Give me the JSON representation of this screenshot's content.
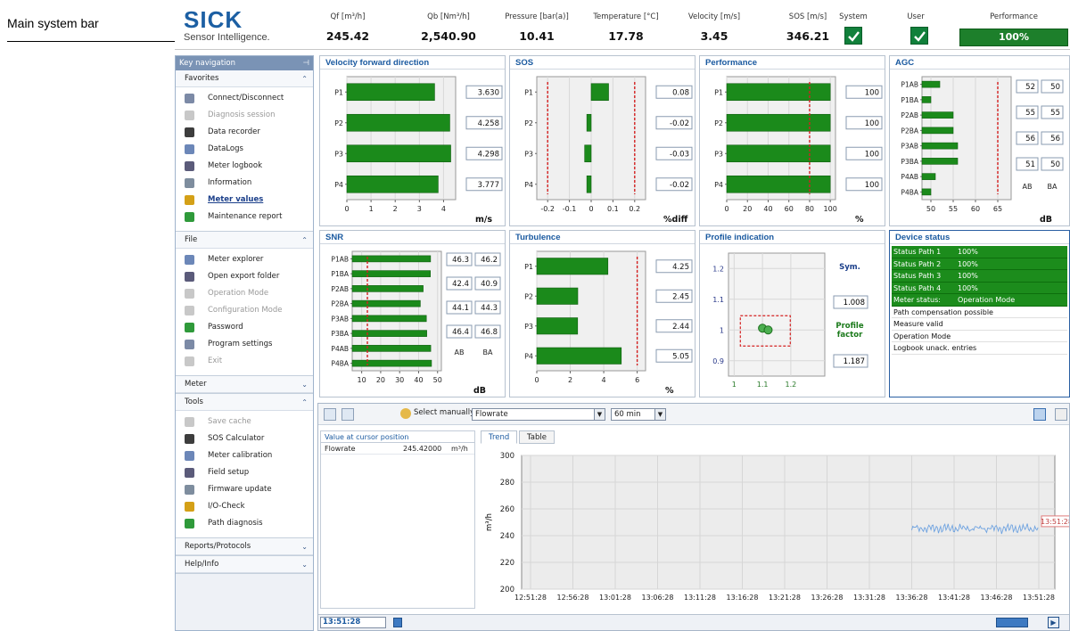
{
  "callout": {
    "label": "Main system bar"
  },
  "brand": {
    "name": "SICK",
    "tagline": "Sensor Intelligence."
  },
  "system_bar": {
    "metrics": [
      {
        "header": "Qf [m³/h]",
        "value": "245.42"
      },
      {
        "header": "Qb [Nm³/h]",
        "value": "2,540.90"
      },
      {
        "header": "Pressure [bar(a)]",
        "value": "10.41"
      },
      {
        "header": "Temperature [°C]",
        "value": "17.78"
      },
      {
        "header": "Velocity [m/s]",
        "value": "3.45"
      },
      {
        "header": "SOS [m/s]",
        "value": "346.21"
      }
    ],
    "system_label": "System",
    "user_label": "User",
    "performance_label": "Performance",
    "performance_value": "100%",
    "performance_level": 1.0,
    "colors": {
      "check": "#11803b",
      "performance": "#1d7f2b",
      "accent": "#1b5aa0"
    }
  },
  "sidebar": {
    "title": "Key navigation",
    "groups": [
      {
        "name": "Favorites",
        "expanded": true,
        "items": [
          {
            "label": "Connect/Disconnect",
            "icon": "plug-icon",
            "enabled": true
          },
          {
            "label": "Diagnosis session",
            "icon": "diagnosis-icon",
            "enabled": false
          },
          {
            "label": "Data recorder",
            "icon": "recorder-icon",
            "enabled": true
          },
          {
            "label": "DataLogs",
            "icon": "datalogs-icon",
            "enabled": true
          },
          {
            "label": "Meter logbook",
            "icon": "logbook-icon",
            "enabled": true
          },
          {
            "label": "Information",
            "icon": "information-icon",
            "enabled": true
          },
          {
            "label": "Meter values",
            "icon": "meter-values-icon",
            "enabled": true,
            "active": true
          },
          {
            "label": "Maintenance report",
            "icon": "report-icon",
            "enabled": true
          }
        ]
      },
      {
        "name": "File",
        "expanded": true,
        "items": [
          {
            "label": "Meter explorer",
            "icon": "explorer-icon",
            "enabled": true
          },
          {
            "label": "Open export folder",
            "icon": "folder-icon",
            "enabled": true
          },
          {
            "label": "Operation Mode",
            "icon": "operation-icon",
            "enabled": false
          },
          {
            "label": "Configuration Mode",
            "icon": "configuration-icon",
            "enabled": false
          },
          {
            "label": "Password",
            "icon": "password-icon",
            "enabled": true
          },
          {
            "label": "Program settings",
            "icon": "settings-icon",
            "enabled": true
          },
          {
            "label": "Exit",
            "icon": "exit-icon",
            "enabled": false
          }
        ]
      },
      {
        "name": "Meter",
        "expanded": false,
        "items": []
      },
      {
        "name": "Tools",
        "expanded": true,
        "items": [
          {
            "label": "Save cache",
            "icon": "cache-icon",
            "enabled": false
          },
          {
            "label": "SOS Calculator",
            "icon": "calculator-icon",
            "enabled": true
          },
          {
            "label": "Meter calibration",
            "icon": "calibration-icon",
            "enabled": true
          },
          {
            "label": "Field setup",
            "icon": "field-setup-icon",
            "enabled": true
          },
          {
            "label": "Firmware update",
            "icon": "firmware-icon",
            "enabled": true
          },
          {
            "label": "I/O-Check",
            "icon": "io-check-icon",
            "enabled": true
          },
          {
            "label": "Path diagnosis",
            "icon": "path-diagnosis-icon",
            "enabled": true
          }
        ]
      },
      {
        "name": "Reports/Protocols",
        "expanded": false,
        "items": []
      },
      {
        "name": "Help/Info",
        "expanded": false,
        "items": []
      }
    ]
  },
  "chart_data": [
    {
      "id": "velocity",
      "type": "bar",
      "title": "Velocity  forward direction",
      "categories": [
        "P1",
        "P2",
        "P3",
        "P4"
      ],
      "values": [
        3.63,
        4.258,
        4.298,
        3.777
      ],
      "value_labels": [
        "3.630",
        "4.258",
        "4.298",
        "3.777"
      ],
      "unit": "m/s",
      "xlim": [
        0,
        4.5
      ],
      "xticks": [
        "0",
        "1",
        "2",
        "3",
        "4"
      ]
    },
    {
      "id": "sos",
      "type": "bar",
      "title": "SOS",
      "categories": [
        "P1",
        "P2",
        "P3",
        "P4"
      ],
      "values": [
        0.08,
        -0.02,
        -0.03,
        -0.02
      ],
      "value_labels": [
        "0.08",
        "-0.02",
        "-0.03",
        "-0.02"
      ],
      "unit": "%diff",
      "xlim": [
        -0.25,
        0.25
      ],
      "xticks": [
        "-0.2",
        "-0.1",
        "0",
        "0.1",
        "0.2"
      ],
      "limits": [
        -0.2,
        0.2
      ]
    },
    {
      "id": "performance",
      "type": "bar",
      "title": "Performance",
      "categories": [
        "P1",
        "P2",
        "P3",
        "P4"
      ],
      "values": [
        100,
        100,
        100,
        100
      ],
      "value_labels": [
        "100",
        "100",
        "100",
        "100"
      ],
      "unit": "%",
      "xlim": [
        0,
        105
      ],
      "xticks": [
        "0",
        "20",
        "40",
        "60",
        "80",
        "100"
      ],
      "limits": [
        80
      ]
    },
    {
      "id": "agc",
      "type": "bar",
      "title": "AGC",
      "categories": [
        "P1AB",
        "P1BA",
        "P2AB",
        "P2BA",
        "P3AB",
        "P3BA",
        "P4AB",
        "P4BA"
      ],
      "values": [
        52,
        50,
        55,
        55,
        56,
        56,
        51,
        50
      ],
      "value_labels": [
        "52",
        "50",
        "55",
        "55",
        "56",
        "56",
        "51",
        "50"
      ],
      "unit": "dB",
      "xlim": [
        48,
        68
      ],
      "xticks": [
        "50",
        "55",
        "60",
        "65"
      ],
      "limits": [
        65
      ],
      "col_labels": [
        "AB",
        "BA"
      ]
    },
    {
      "id": "snr",
      "type": "bar",
      "title": "SNR",
      "categories": [
        "P1AB",
        "P1BA",
        "P2AB",
        "P2BA",
        "P3AB",
        "P3BA",
        "P4AB",
        "P4BA"
      ],
      "values": [
        46.3,
        46.2,
        42.4,
        40.9,
        44.1,
        44.3,
        46.4,
        46.8
      ],
      "value_labels": [
        "46.3",
        "46.2",
        "42.4",
        "40.9",
        "44.1",
        "44.3",
        "46.4",
        "46.8"
      ],
      "unit": "dB",
      "xlim": [
        5,
        52
      ],
      "xticks": [
        "10",
        "20",
        "30",
        "40",
        "50"
      ],
      "limits": [
        13
      ],
      "col_labels": [
        "AB",
        "BA"
      ]
    },
    {
      "id": "turbulence",
      "type": "bar",
      "title": "Turbulence",
      "categories": [
        "P1",
        "P2",
        "P3",
        "P4"
      ],
      "values": [
        4.25,
        2.45,
        2.44,
        5.05
      ],
      "value_labels": [
        "4.25",
        "2.45",
        "2.44",
        "5.05"
      ],
      "unit": "%",
      "xlim": [
        0,
        6.5
      ],
      "xticks": [
        "0",
        "2",
        "4",
        "6"
      ],
      "limits": [
        6
      ]
    },
    {
      "id": "profile",
      "type": "scatter",
      "title": "Profile indication",
      "x": [
        1.1,
        1.12
      ],
      "y": [
        1.0,
        1.0
      ],
      "xticks": [
        "1",
        "1.1",
        "1.2"
      ],
      "yticks": [
        "1.2",
        "1.1",
        "1",
        "0.9"
      ],
      "xlim": [
        0.98,
        1.32
      ],
      "ylim": [
        0.85,
        1.25
      ],
      "symmetry_label": "Sym.",
      "symmetry": "1.008",
      "factor_label": "Profile factor",
      "factor": "1.187"
    },
    {
      "id": "trend",
      "type": "line",
      "title": "",
      "ylabel": "m³/h",
      "ylim": [
        200,
        300
      ],
      "yticks": [
        "300",
        "280",
        "260",
        "240",
        "220",
        "200"
      ],
      "xticks": [
        "12:51:28",
        "12:56:28",
        "13:01:28",
        "13:06:28",
        "13:11:28",
        "13:16:28",
        "13:21:28",
        "13:26:28",
        "13:31:28",
        "13:36:28",
        "13:41:28",
        "13:46:28",
        "13:51:28"
      ],
      "series": [
        {
          "values_from": "13:36:28",
          "level": 245.4
        }
      ],
      "cursor_label": "13:51:28"
    }
  ],
  "device_status": {
    "title": "Device status",
    "rows": [
      {
        "label": "Status Path 1",
        "value": "100%",
        "ok": true
      },
      {
        "label": "Status Path 2",
        "value": "100%",
        "ok": true
      },
      {
        "label": "Status Path 3",
        "value": "100%",
        "ok": true
      },
      {
        "label": "Status Path 4",
        "value": "100%",
        "ok": true
      },
      {
        "label": "Meter status:",
        "value": "Operation Mode",
        "ok": true
      },
      {
        "label": "Path compensation possible",
        "value": "",
        "ok": false
      },
      {
        "label": "Measure valid",
        "value": "",
        "ok": false
      },
      {
        "label": "Operation Mode",
        "value": "",
        "ok": false
      },
      {
        "label": "Logbook unack. entries",
        "value": "",
        "ok": false
      }
    ]
  },
  "bottom": {
    "select_label": "Select manually",
    "value_select": "Flowrate",
    "time_select": "60 min",
    "cursor_header": "Value at cursor position",
    "cursor_name": "Flowrate",
    "cursor_value": "245.42000",
    "cursor_unit": "m³/h",
    "tabs": [
      "Trend",
      "Table"
    ],
    "status_time": "13:51:28"
  }
}
